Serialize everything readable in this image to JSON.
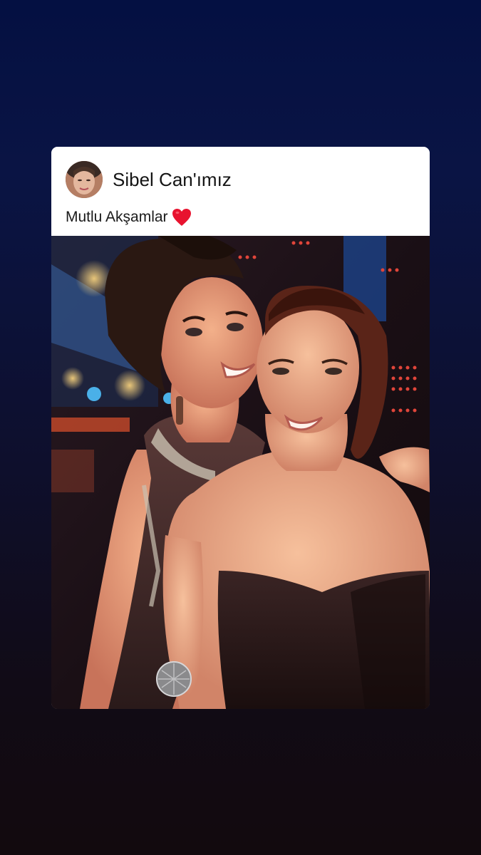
{
  "post": {
    "author": "Sibel Can'ımız",
    "text": "Mutlu Akşamlar",
    "emoji": "red-heart-icon"
  },
  "colors": {
    "background_top": "#041042",
    "background_bottom": "#120a0e",
    "card": "#ffffff",
    "heart": "#e8132f"
  }
}
